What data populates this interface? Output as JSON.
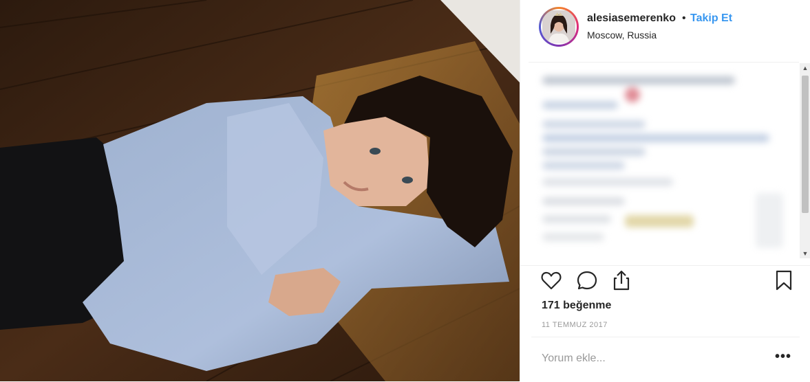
{
  "post": {
    "photo_alt": "",
    "username": "alesiasemerenko",
    "separator": "•",
    "follow_label": "Takip Et",
    "location": "Moscow, Russia",
    "likes": "171 beğenme",
    "date": "11 TEMMUZ 2017",
    "comment_placeholder": "Yorum ekle...",
    "more_label": "•••"
  },
  "icons": {
    "like": "heart-icon",
    "comment": "comment-icon",
    "share": "share-icon",
    "save": "bookmark-icon",
    "scroll_up": "▲",
    "scroll_down": "▼"
  },
  "colors": {
    "follow": "#3897f0",
    "text": "#262626",
    "muted": "#999999",
    "border": "#efefef"
  }
}
